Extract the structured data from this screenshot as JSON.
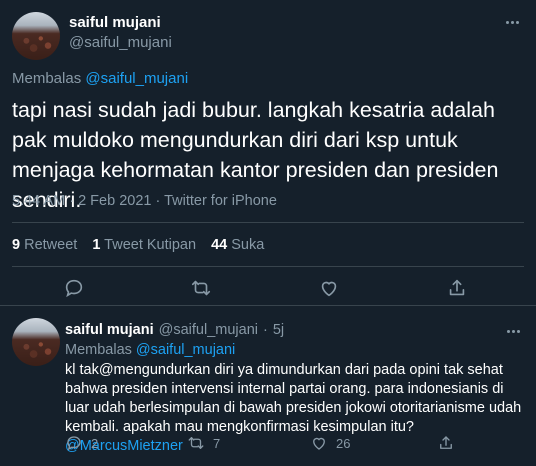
{
  "main_tweet": {
    "author_name": "saiful mujani",
    "author_handle": "@saiful_mujani",
    "reply_prefix": "Membalas",
    "reply_to_handle": "@saiful_mujani",
    "text": "tapi nasi sudah jadi bubur. langkah kesatria adalah pak muldoko mengundurkan diri dari ksp untuk menjaga kehormatan kantor presiden dan presiden sendiri.",
    "meta": "5.44 AM · 2 Feb 2021 · Twitter for iPhone",
    "stats": {
      "retweets_count": "9",
      "retweets_label": "Retweet",
      "quotes_count": "1",
      "quotes_label": "Tweet Kutipan",
      "likes_count": "44",
      "likes_label": "Suka"
    },
    "icons": [
      "more-icon",
      "reply-icon",
      "retweet-icon",
      "like-icon",
      "share-icon"
    ]
  },
  "reply_tweet": {
    "author_name": "saiful mujani",
    "author_handle": "@saiful_mujani",
    "separator": "·",
    "time": "5j",
    "reply_prefix": "Membalas",
    "reply_to_handle": "@saiful_mujani",
    "text": "kl tak@mengundurkan diri ya dimundurkan dari pada opini tak sehat bahwa presiden intervensi internal partai orang. para indonesianis di luar udah berlesimpulan di bawah presiden jokowi otoritarianisme udah kembali. apakah mau mengkonfirmasi kesimpulan itu?",
    "mention": "@MarcusMietzner",
    "reply_count": "2",
    "retweet_count": "7",
    "like_count": "26"
  },
  "colors": {
    "background": "#15202b",
    "text": "#ffffff",
    "muted": "#8899a6",
    "link": "#1da1f2",
    "divider": "#38444d"
  }
}
